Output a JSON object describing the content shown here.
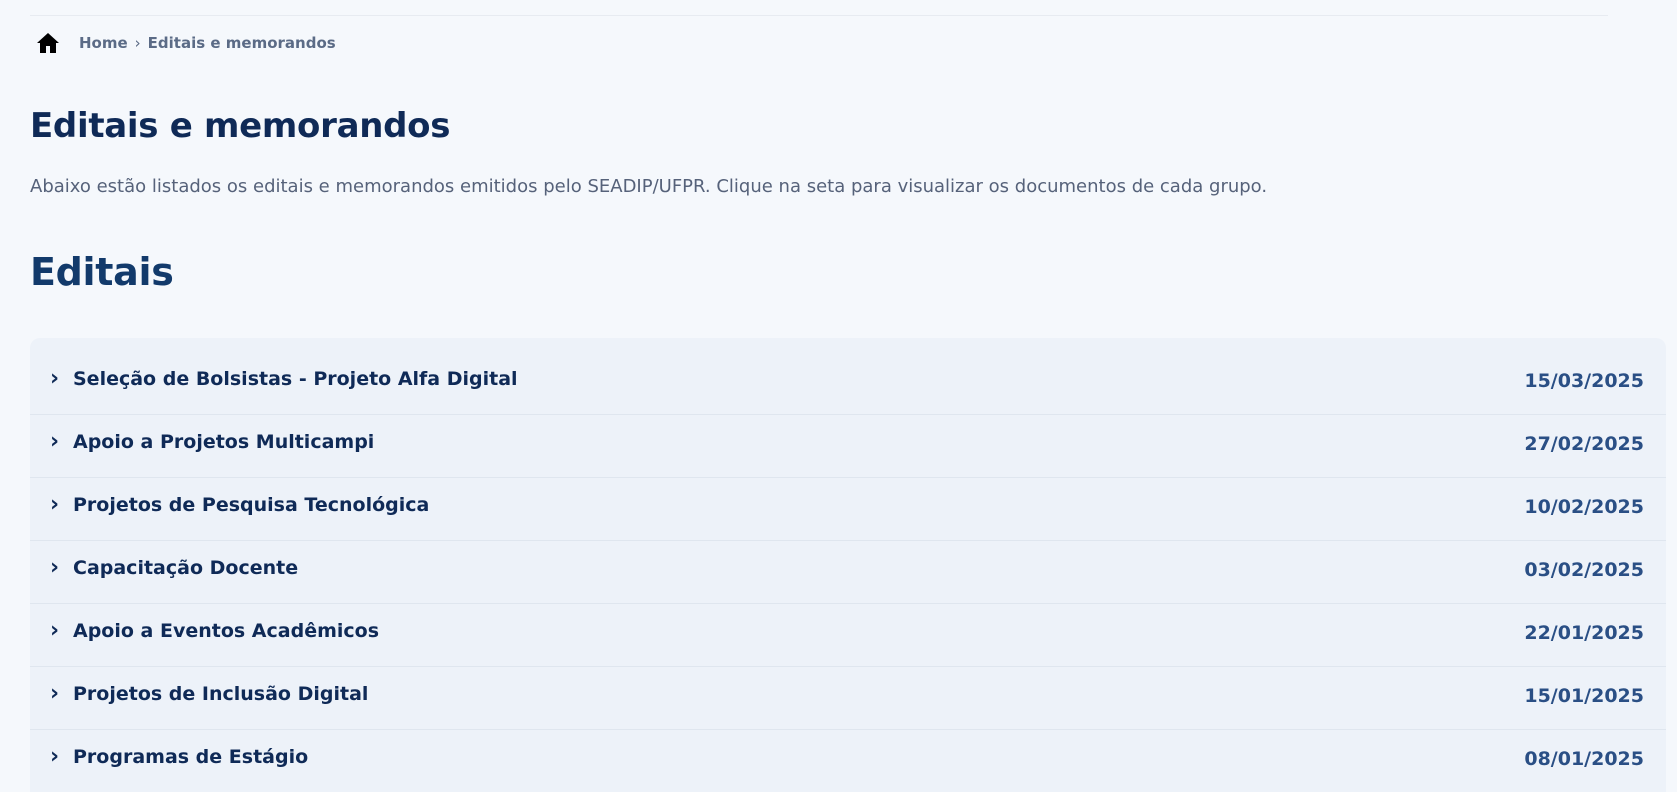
{
  "breadcrumb": {
    "home_icon": "home-icon",
    "home": "Home",
    "separator": "›",
    "current": "Editais e memorandos"
  },
  "page": {
    "title": "Editais e memorandos",
    "intro": "Abaixo estão listados os editais e memorandos emitidos pelo SEADIP/UFPR. Clique na seta para visualizar os documentos de cada grupo."
  },
  "editais": {
    "heading": "Editais",
    "expand_icon": "chevron-right-icon",
    "items": [
      {
        "chevron": "›",
        "title": "Seleção de Bolsistas - Projeto Alfa Digital",
        "date": "15/03/2025"
      },
      {
        "chevron": "›",
        "title": "Apoio a Projetos Multicampi",
        "date": "27/02/2025"
      },
      {
        "chevron": "›",
        "title": "Projetos de Pesquisa Tecnológica",
        "date": "10/02/2025"
      },
      {
        "chevron": "›",
        "title": "Capacitação Docente",
        "date": "03/02/2025"
      },
      {
        "chevron": "›",
        "title": "Apoio a Eventos Acadêmicos",
        "date": "22/01/2025"
      },
      {
        "chevron": "›",
        "title": "Projetos de Inclusão Digital",
        "date": "15/01/2025"
      },
      {
        "chevron": "›",
        "title": "Programas de Estágio",
        "date": "08/01/2025"
      }
    ]
  },
  "colors": {
    "page_bg": "#f5f8fc",
    "list_bg": "#edf2f9",
    "title": "#0f2a57",
    "date": "#2a4f85",
    "breadcrumb": "#5b6b86"
  }
}
